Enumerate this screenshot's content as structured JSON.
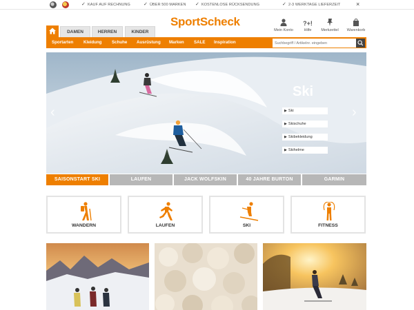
{
  "topbar": {
    "usps": [
      "KAUF AUF RECHNUNG",
      "ÜBER 500 MARKEN",
      "KOSTENLOSE RÜCKSENDUNG",
      "2-3 WERKTAGE LIEFERZEIT"
    ],
    "close": "×"
  },
  "header": {
    "logo": "SportScheck",
    "icons": [
      {
        "icon": "user-icon",
        "label": "Mein Konto"
      },
      {
        "icon": "help-icon",
        "label": "Hilfe"
      },
      {
        "icon": "pin-icon",
        "label": "Merkzettel"
      },
      {
        "icon": "cart-icon",
        "label": "Warenkorb"
      }
    ],
    "help_glyph": "?+!"
  },
  "gender_tabs": [
    "DAMEN",
    "HERREN",
    "KINDER"
  ],
  "nav": {
    "items": [
      "Sportarten",
      "Kleidung",
      "Schuhe",
      "Ausrüstung",
      "Marken",
      "SALE",
      "Inspiration"
    ],
    "search_placeholder": "Suchbegriff / Artikelnr. eingeben"
  },
  "hero": {
    "title": "Ski",
    "links": [
      "Ski",
      "Skischuhe",
      "Skibekleidung",
      "Skihelme"
    ],
    "prev": "‹",
    "next": "›"
  },
  "hero_tabs": [
    "SAISONSTART SKI",
    "LAUFEN",
    "JACK WOLFSKIN",
    "40 JAHRE BURTON",
    "GARMIN"
  ],
  "categories": [
    {
      "label": "WANDERN",
      "icon": "hiker-icon"
    },
    {
      "label": "LAUFEN",
      "icon": "runner-icon"
    },
    {
      "label": "SKI",
      "icon": "skier-icon"
    },
    {
      "label": "FITNESS",
      "icon": "jump-rope-icon"
    }
  ],
  "colors": {
    "accent": "#ee7f00",
    "tab_inactive": "#b7b7b7",
    "nav_text": "#ffffff"
  }
}
